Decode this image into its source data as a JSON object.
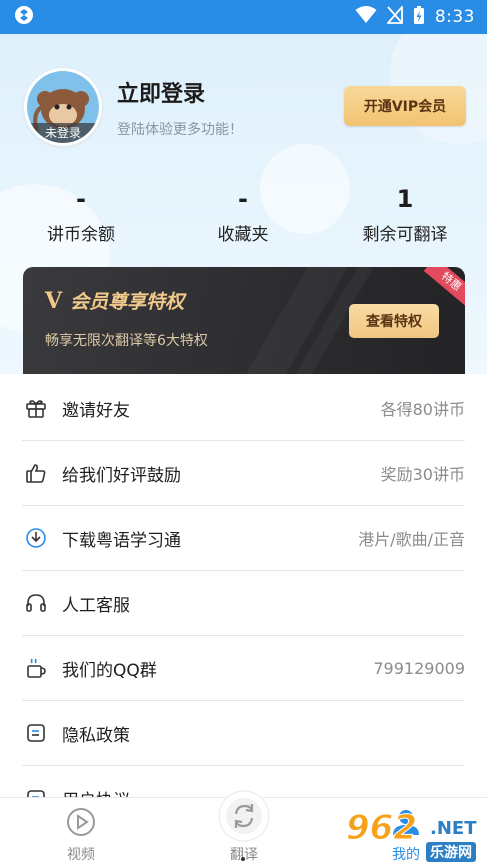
{
  "status_bar": {
    "time": "8:33",
    "colors": {
      "background": "#2a8de5"
    }
  },
  "profile": {
    "avatar_badge": "未登录",
    "title": "立即登录",
    "subtitle": "登陆体验更多功能！",
    "vip_button": "开通VIP会员"
  },
  "stats": [
    {
      "value": "-",
      "label": "讲币余额"
    },
    {
      "value": "-",
      "label": "收藏夹"
    },
    {
      "value": "1",
      "label": "剩余可翻译"
    }
  ],
  "vip_card": {
    "logo": "V",
    "title": "会员尊享特权",
    "subtitle": "畅享无限次翻译等6大特权",
    "button": "查看特权",
    "ribbon": "特惠"
  },
  "menu": [
    {
      "icon": "gift-icon",
      "label": "邀请好友",
      "value": "各得80讲币"
    },
    {
      "icon": "thumbs-up-icon",
      "label": "给我们好评鼓励",
      "value": "奖励30讲币"
    },
    {
      "icon": "download-icon",
      "label": "下载粤语学习通",
      "value": "港片/歌曲/正音"
    },
    {
      "icon": "headset-icon",
      "label": "人工客服",
      "value": ""
    },
    {
      "icon": "coffee-cup-icon",
      "label": "我们的QQ群",
      "value": "799129009"
    },
    {
      "icon": "document-icon",
      "label": "隐私政策",
      "value": ""
    },
    {
      "icon": "document-icon",
      "label": "用户协议",
      "value": ""
    }
  ],
  "bottom_nav": [
    {
      "icon": "play-icon",
      "label": "视频"
    },
    {
      "icon": "refresh-icon",
      "label": "翻译"
    },
    {
      "icon": "user-icon",
      "label": "我的"
    }
  ],
  "watermark": {
    "number": "962",
    "net": ".NET",
    "site": "乐游网"
  }
}
